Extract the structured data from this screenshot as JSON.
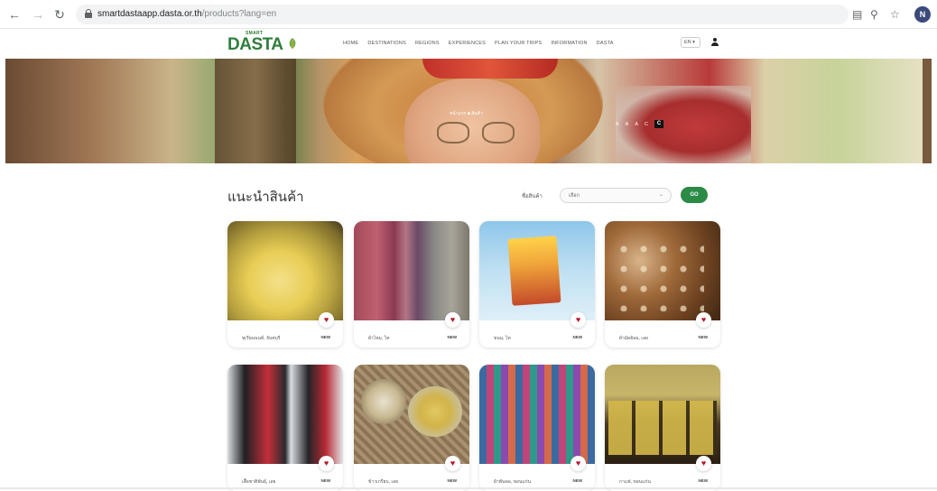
{
  "browser": {
    "url_host": "smartdastaapp.dasta.or.th",
    "url_path": "/products?lang=en",
    "profile_initial": "N",
    "icons": [
      "back-icon",
      "forward-icon",
      "reload-icon",
      "lock-icon",
      "translate-icon",
      "zoom-icon",
      "star-icon"
    ]
  },
  "site": {
    "logo_small": "SMART",
    "logo_main": "DASTA",
    "menu": [
      "HOME",
      "DESTINATIONS",
      "REGIONS",
      "EXPERIENCES",
      "PLAN YOUR TRIPS",
      "INFORMATION",
      "DASTA"
    ],
    "language": "EN ▾",
    "accent_color": "#2c8a47"
  },
  "hero": {
    "caption": "หน้าแรก ■ สินค้า",
    "font_tools": [
      "A",
      "A",
      "A",
      "C",
      "C"
    ]
  },
  "products_section": {
    "title": "แนะนำสินค้า",
    "search_label": "ชื่อสินค้า",
    "search_value": "เลือก",
    "search_button": "GO",
    "cards": [
      {
        "name": "ทุเรียนนนท์, จันทบุรี",
        "tag": "NEW"
      },
      {
        "name": "ผ้าไหม, ไท",
        "tag": "NEW"
      },
      {
        "name": "ขนม, ไท",
        "tag": "NEW"
      },
      {
        "name": "ผ้ามัดย้อม, เลย",
        "tag": "NEW"
      },
      {
        "name": "เสื้อชาติพันธุ์, เลย",
        "tag": "NEW"
      },
      {
        "name": "ข้าวเกรียบ, เลย",
        "tag": "NEW"
      },
      {
        "name": "ผ้าพันคอ, ขอนแก่น",
        "tag": "NEW"
      },
      {
        "name": "กาแฟ, ขอนแก่น",
        "tag": "NEW"
      }
    ]
  }
}
